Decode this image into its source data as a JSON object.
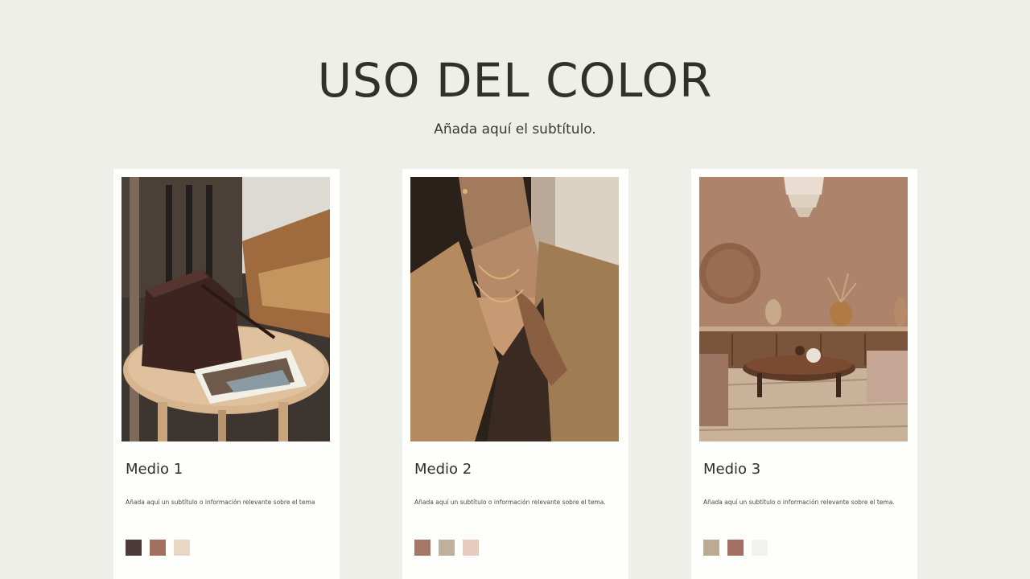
{
  "slide": {
    "title": "USO DEL COLOR",
    "subtitle": "Añada aquí el subtítulo."
  },
  "cards": [
    {
      "title": "Medio 1",
      "description": "Añada aquí un subtítulo o información relevante sobre el tema",
      "image": "brown-bucket-bag-on-round-wooden-side-table",
      "swatches": [
        "#4d3b3b",
        "#a2705f",
        "#e8d8c3"
      ]
    },
    {
      "title": "Medio 2",
      "description": "Añada aquí un subtítulo o información relevante sobre el tema.",
      "image": "woman-in-beige-blazer-with-gold-necklace",
      "swatches": [
        "#a47766",
        "#bfb09c",
        "#e8cbbd"
      ]
    },
    {
      "title": "Medio 3",
      "description": "Añada aquí un subtítulo o información relevante sobre el tema.",
      "image": "terracotta-living-room-with-wooden-coffee-table",
      "swatches": [
        "#bbab93",
        "#a37063",
        "#f3f2ec"
      ]
    }
  ]
}
